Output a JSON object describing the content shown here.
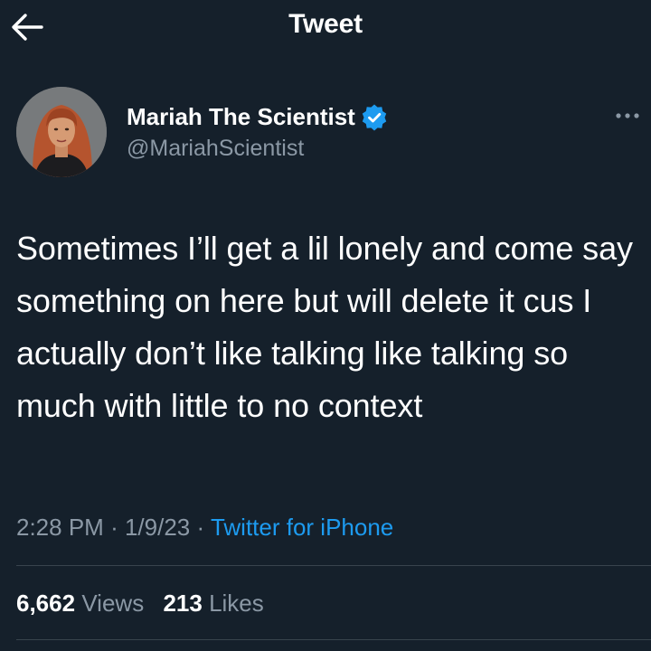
{
  "header": {
    "title": "Tweet",
    "back_icon": "arrow-left-icon"
  },
  "author": {
    "display_name": "Mariah The Scientist",
    "handle": "@MariahScientist",
    "verified": true,
    "verified_color": "#1d9bf0",
    "more_icon": "more-horizontal-icon"
  },
  "tweet": {
    "text": "Sometimes I’ll get a lil lonely and come say something on here but will delete it cus I actually don’t like talking like talking so much with little to no context",
    "time": "2:28 PM",
    "date": "1/9/23",
    "separator": "·",
    "source": "Twitter for iPhone"
  },
  "stats": {
    "views_count": "6,662",
    "views_label": "Views",
    "likes_count": "213",
    "likes_label": "Likes"
  },
  "colors": {
    "background": "#15202b",
    "text_primary": "#ffffff",
    "text_secondary": "#8b98a5",
    "accent": "#1d9bf0",
    "divider": "#38444d"
  }
}
